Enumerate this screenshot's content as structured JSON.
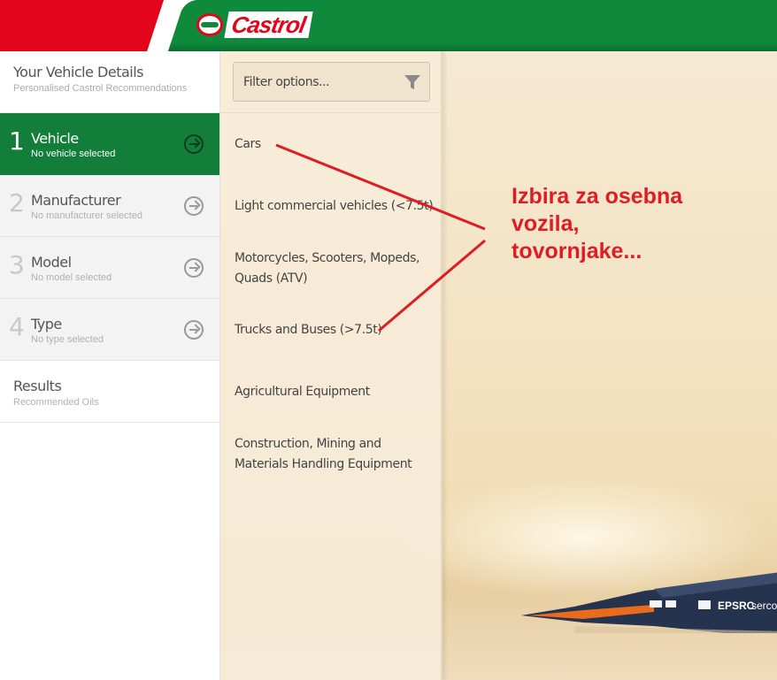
{
  "header": {
    "logo_text": "Castrol",
    "colors": {
      "red": "#e3051b",
      "green": "#0f8a3c"
    }
  },
  "sidebar": {
    "title": "Your Vehicle Details",
    "subtitle": "Personalised Castrol Recommendations",
    "steps": [
      {
        "num": "1",
        "title": "Vehicle",
        "sub": "No vehicle selected",
        "active": true
      },
      {
        "num": "2",
        "title": "Manufacturer",
        "sub": "No manufacturer selected",
        "active": false
      },
      {
        "num": "3",
        "title": "Model",
        "sub": "No model selected",
        "active": false
      },
      {
        "num": "4",
        "title": "Type",
        "sub": "No type selected",
        "active": false
      }
    ],
    "results": {
      "title": "Results",
      "sub": "Recommended Oils"
    },
    "active_color": "#137d3a"
  },
  "filter": {
    "placeholder": "Filter options..."
  },
  "categories": [
    "Cars",
    "Light commercial vehicles (<7.5t)",
    "Motorcycles, Scooters, Mopeds, Quads (ATV)",
    "Trucks and Buses (>7.5t)",
    "Agricultural Equipment",
    "Construction, Mining and Materials Handling Equipment"
  ],
  "annotation": {
    "lines": [
      "Izbira za osebna",
      "vozila,",
      "tovornjake..."
    ],
    "color": "#dd1d24"
  },
  "car_livery": [
    "EPSRC",
    "serco"
  ]
}
